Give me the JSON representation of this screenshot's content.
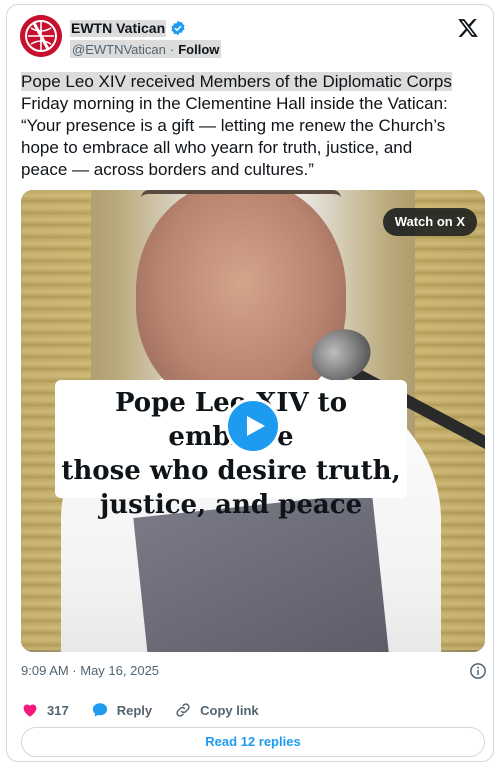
{
  "author": {
    "name": "EWTN Vatican",
    "handle": "@EWTNVatican",
    "separator": "·",
    "follow_label": "Follow",
    "verified": true
  },
  "tweet": {
    "text_line1": "Pope Leo XIV received Members of the Diplomatic Corps",
    "text_line2": "Friday morning in the Clementine Hall inside the Vatican:",
    "text_line3": "“Your presence is a gift — letting me renew the Church’s",
    "text_line4": "hope to embrace all who yearn for truth, justice, and",
    "text_line5": "peace — across borders and cultures.”"
  },
  "media": {
    "watch_label": "Watch on X",
    "caption_line1": "Pope Leo XIV to embrace",
    "caption_line2": "those who desire truth,",
    "caption_line3": "justice, and peace"
  },
  "meta": {
    "timestamp": "9:09 AM · May 16, 2025"
  },
  "actions": {
    "like_count": "317",
    "reply_label": "Reply",
    "copy_label": "Copy link"
  },
  "footer": {
    "read_replies_label": "Read 12 replies"
  },
  "colors": {
    "accent": "#1d9bf0",
    "like": "#f91880",
    "brand_red": "#c8102e"
  }
}
